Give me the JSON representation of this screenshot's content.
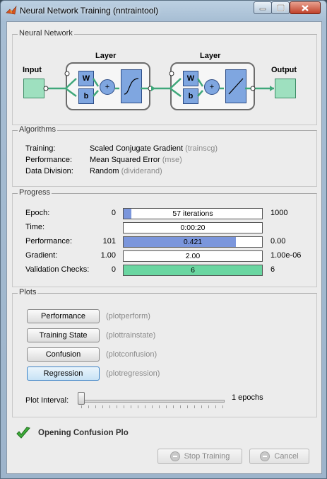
{
  "window": {
    "title": "Neural Network Training (nntraintool)"
  },
  "network": {
    "section_title": "Neural Network",
    "input_label": "Input",
    "output_label": "Output",
    "layers": [
      {
        "label": "Layer",
        "weight": "W",
        "bias": "b",
        "sum": "+"
      },
      {
        "label": "Layer",
        "weight": "W",
        "bias": "b",
        "sum": "+"
      }
    ]
  },
  "algorithms": {
    "section_title": "Algorithms",
    "rows": [
      {
        "label": "Training:",
        "value": "Scaled Conjugate Gradient",
        "fn": "(trainscg)"
      },
      {
        "label": "Performance:",
        "value": "Mean Squared Error",
        "fn": "(mse)"
      },
      {
        "label": "Data Division:",
        "value": "Random",
        "fn": "(dividerand)"
      }
    ]
  },
  "progress": {
    "section_title": "Progress",
    "rows": [
      {
        "label": "Epoch:",
        "start": "0",
        "text": "57 iterations",
        "end": "1000",
        "fill": 0.057,
        "color": "#7b96dc"
      },
      {
        "label": "Time:",
        "start": "",
        "text": "0:00:20",
        "end": "",
        "fill": 0,
        "color": "#7b96dc"
      },
      {
        "label": "Performance:",
        "start": "101",
        "text": "0.421",
        "end": "0.00",
        "fill": 0.81,
        "color": "#7b96dc"
      },
      {
        "label": "Gradient:",
        "start": "1.00",
        "text": "2.00",
        "end": "1.00e-06",
        "fill": 0,
        "color": "#7b96dc"
      },
      {
        "label": "Validation Checks:",
        "start": "0",
        "text": "6",
        "end": "6",
        "fill": 1.0,
        "color": "#6ad6a1"
      }
    ]
  },
  "plots": {
    "section_title": "Plots",
    "buttons": [
      {
        "label": "Performance",
        "fn": "(plotperform)"
      },
      {
        "label": "Training State",
        "fn": "(plottrainstate)"
      },
      {
        "label": "Confusion",
        "fn": "(plotconfusion)"
      },
      {
        "label": "Regression",
        "fn": "(plotregression)"
      }
    ],
    "interval_label": "Plot Interval:",
    "interval_value": "1 epochs",
    "interval_fraction": 0.0
  },
  "status": {
    "text": "Opening Confusion Plo"
  },
  "footer": {
    "stop_label": "Stop Training",
    "cancel_label": "Cancel"
  }
}
